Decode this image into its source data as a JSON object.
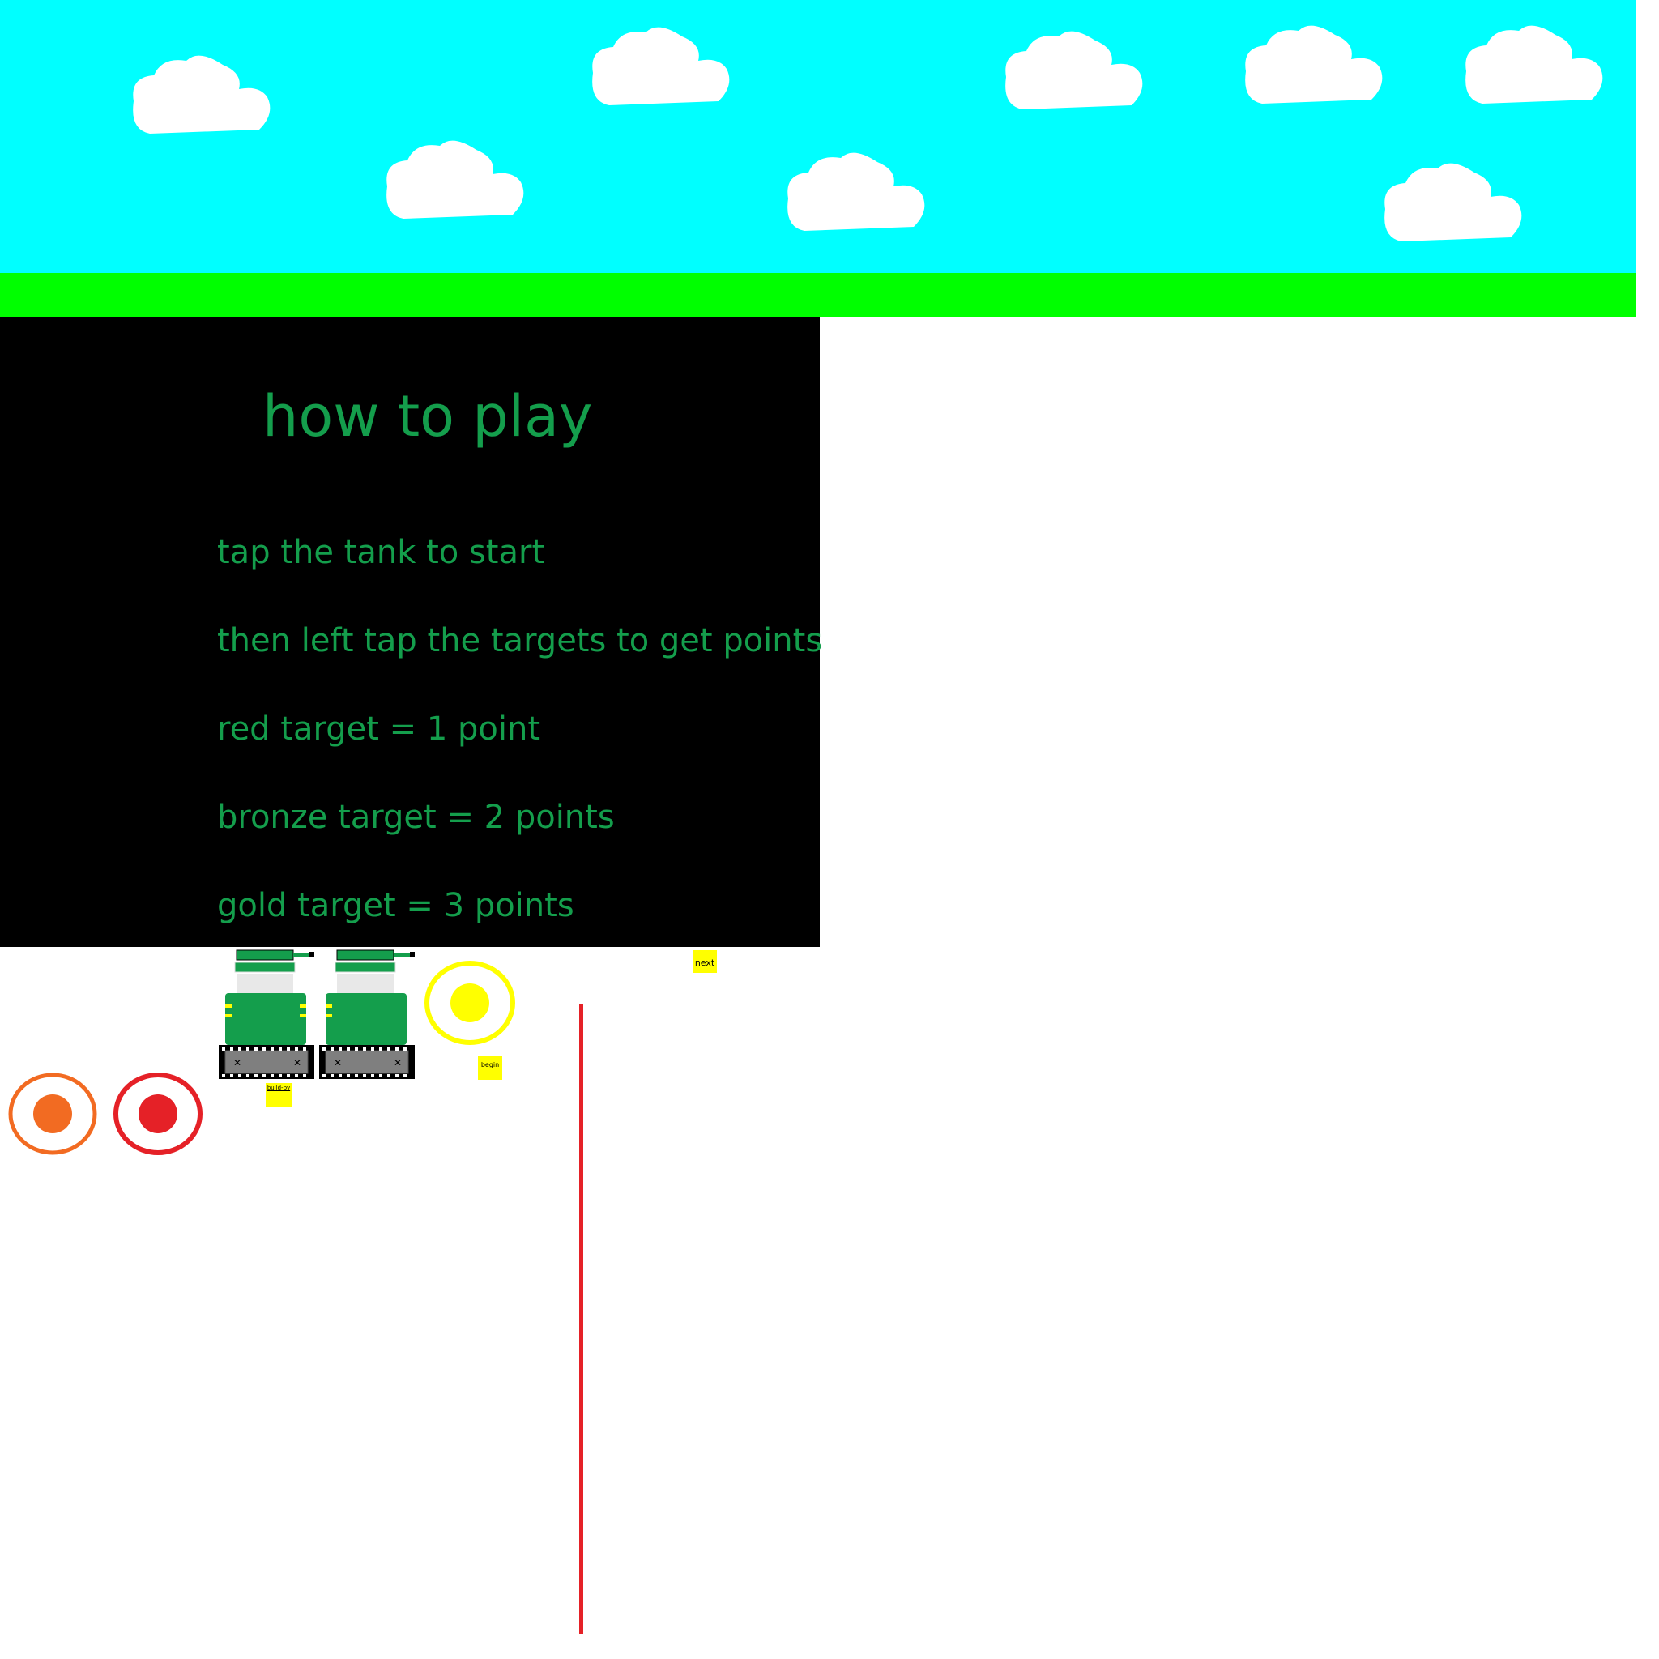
{
  "colors": {
    "sky": "#00ffff",
    "grass": "#00ff00",
    "panel": "#000000",
    "panel_text": "#149e4c",
    "tank_body": "#149e4c",
    "tank_track": "#7f7f7f",
    "red_target": "#e52127",
    "bronze_target": "#f26b22",
    "gold_target": "#ffff00",
    "sticky_note": "#ffff00"
  },
  "how_to_play": {
    "title": "how to play",
    "lines": [
      "tap the tank to start",
      "then left tap the targets to get points",
      "red target = 1 point",
      "bronze target = 2 points",
      "gold target = 3 points"
    ]
  },
  "sprites": {
    "tank_icon": "tank-icon",
    "targets": [
      {
        "name": "bronze-target-icon",
        "points": 2
      },
      {
        "name": "red-target-icon",
        "points": 1
      },
      {
        "name": "gold-target-icon",
        "points": 3
      }
    ]
  },
  "notes": {
    "next_label": "next",
    "build_label": "build-by",
    "begin_label": "begin"
  }
}
